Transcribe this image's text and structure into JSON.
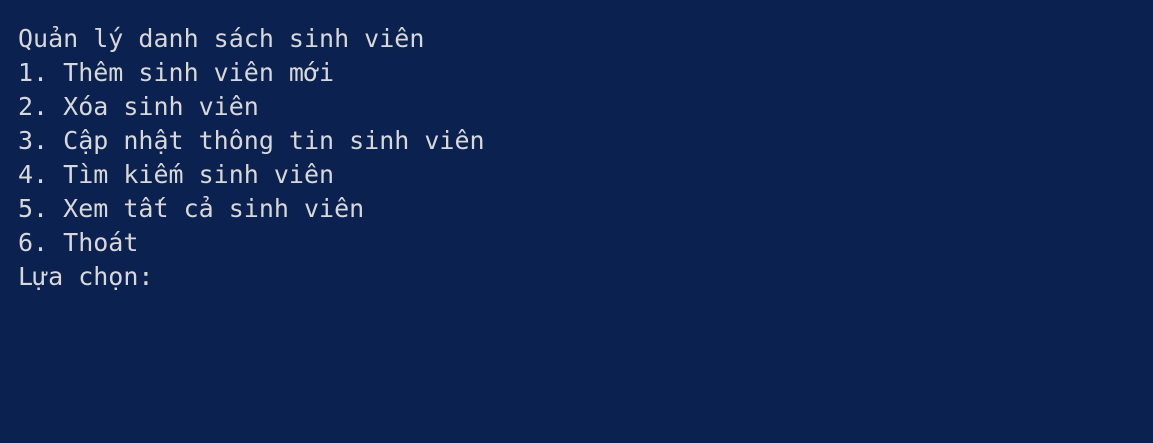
{
  "console": {
    "title": "Quản lý danh sách sinh viên",
    "menu_items": [
      "1. Thêm sinh viên mới",
      "2. Xóa sinh viên",
      "3. Cập nhật thông tin sinh viên",
      "4. Tìm kiếm sinh viên",
      "5. Xem tất cả sinh viên",
      "6. Thoát"
    ],
    "prompt_label": "Lựa chọn: ",
    "input_value": ""
  },
  "colors": {
    "background": "#0b2250",
    "text": "#d8d8d8"
  }
}
